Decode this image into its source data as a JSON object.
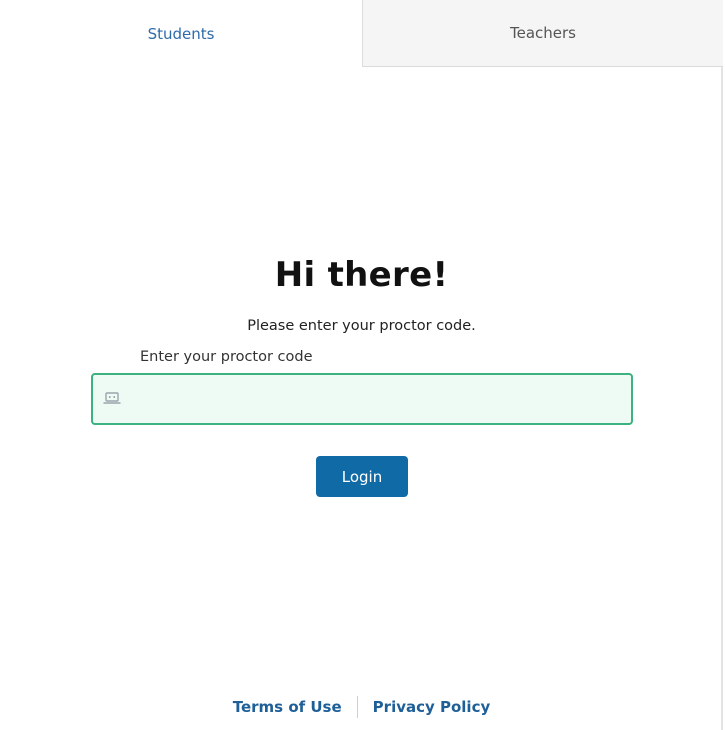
{
  "tabs": {
    "students": "Students",
    "teachers": "Teachers"
  },
  "login": {
    "title": "Hi there!",
    "subtitle": "Please enter your proctor code.",
    "field_label": "Enter your proctor code",
    "proctor_code_value": "",
    "button_label": "Login"
  },
  "footer": {
    "terms": "Terms of Use",
    "privacy": "Privacy Policy"
  },
  "icons": {
    "input_icon": "laptop-icon"
  },
  "colors": {
    "active_tab_text": "#2f6aa9",
    "input_border": "#3bb27f",
    "input_background": "#eefaf4",
    "button_background": "#0f6aa6",
    "footer_link": "#1f5f98"
  }
}
